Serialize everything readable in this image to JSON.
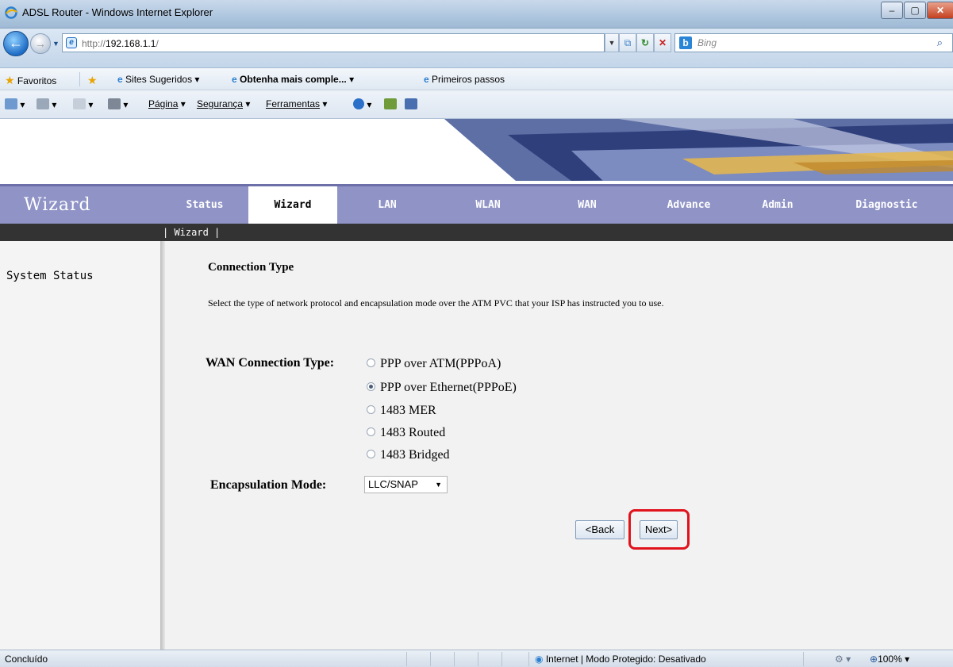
{
  "window": {
    "title": "ADSL Router - Windows Internet Explorer"
  },
  "address_bar": {
    "url_prefix": "http://",
    "url_host": "192.168.1.1",
    "url_suffix": "/"
  },
  "search": {
    "placeholder": "Bing"
  },
  "favorites_bar": {
    "favorites_label": "Favoritos",
    "suggested_sites_label": "Sites Sugeridos",
    "get_more_label": "Obtenha mais comple...",
    "first_steps_label": "Primeiros passos"
  },
  "command_bar": {
    "page_menu": "Página",
    "safety_menu": "Segurança",
    "tools_menu": "Ferramentas"
  },
  "router": {
    "brand": "Wizard",
    "tabs": [
      "Status",
      "Wizard",
      "LAN",
      "WLAN",
      "WAN",
      "Advance",
      "Admin",
      "Diagnostic"
    ],
    "active_tab": "Wizard",
    "subnav_link": "| Wizard |",
    "sidebar_item": "System Status",
    "section_title": "Connection Type",
    "description": "Select the type of network protocol and encapsulation mode over the ATM PVC that your ISP has instructed you to use.",
    "wan_label": "WAN Connection Type:",
    "options": [
      {
        "label": "PPP over ATM(PPPoA)",
        "selected": false
      },
      {
        "label": "PPP over Ethernet(PPPoE)",
        "selected": true
      },
      {
        "label": "1483 MER",
        "selected": false
      },
      {
        "label": "1483 Routed",
        "selected": false
      },
      {
        "label": "1483 Bridged",
        "selected": false
      }
    ],
    "encap_label": "Encapsulation Mode:",
    "encap_value": "LLC/SNAP",
    "back_button": "<Back",
    "next_button": "Next>"
  },
  "status_bar": {
    "left_text": "Concluído",
    "zone_text": "Internet | Modo Protegido: Desativado",
    "zoom": "100%"
  },
  "colors": {
    "nav_bg": "#8f93c6",
    "subnav_bg": "#333333",
    "highlight": "#e0121c"
  }
}
